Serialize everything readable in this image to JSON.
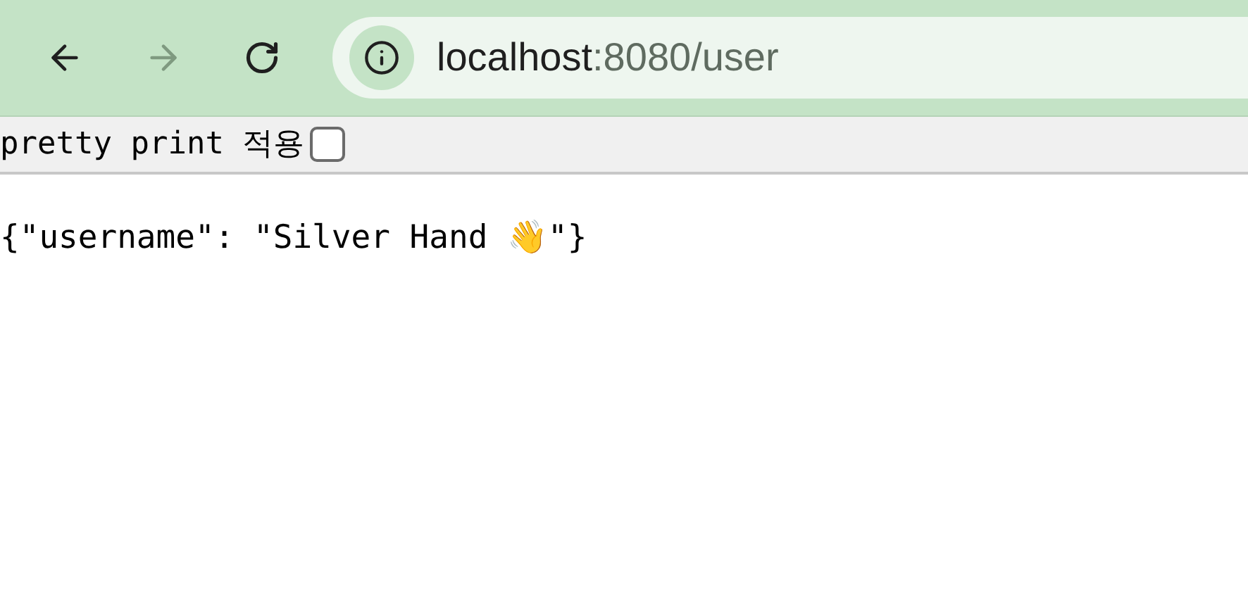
{
  "toolbar": {
    "back": {
      "disabled": false
    },
    "forward": {
      "disabled": true
    },
    "address": {
      "host": "localhost",
      "rest": ":8080/user"
    }
  },
  "pretty_print": {
    "label": "pretty print 적용",
    "checked": false
  },
  "body": "{\"username\": \"Silver Hand 👋\"}"
}
